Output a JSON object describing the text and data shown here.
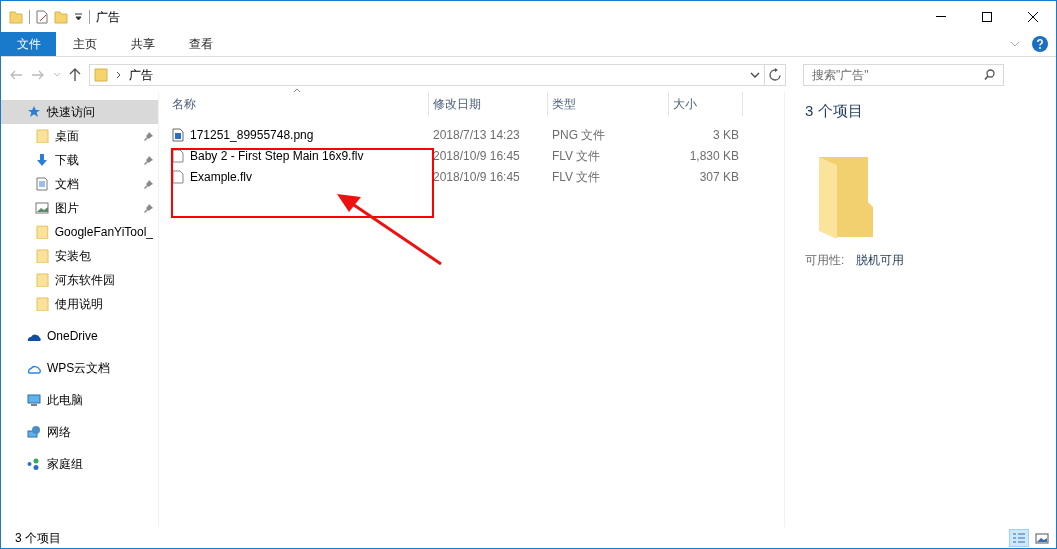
{
  "window": {
    "title": "广告"
  },
  "ribbon_tabs": [
    {
      "label": "文件",
      "kind": "file",
      "selected": false
    },
    {
      "label": "主页",
      "kind": "tab",
      "selected": false
    },
    {
      "label": "共享",
      "kind": "tab",
      "selected": false
    },
    {
      "label": "查看",
      "kind": "tab",
      "selected": false
    }
  ],
  "address_bar": {
    "path": [
      "广告"
    ]
  },
  "search": {
    "placeholder": "搜索\"广告\""
  },
  "sidebar": {
    "items": [
      {
        "label": "快速访问",
        "kind": "star",
        "selected": true,
        "children": [
          {
            "label": "桌面",
            "kind": "folder",
            "pinned": true,
            "selected": false
          },
          {
            "label": "下载",
            "kind": "download",
            "pinned": true,
            "selected": false
          },
          {
            "label": "文档",
            "kind": "document",
            "pinned": true,
            "selected": false
          },
          {
            "label": "图片",
            "kind": "pictures",
            "pinned": true,
            "selected": false
          },
          {
            "label": "GoogleFanYiTool_",
            "kind": "folder",
            "pinned": false,
            "selected": false
          },
          {
            "label": "安装包",
            "kind": "folder",
            "pinned": false,
            "selected": false
          },
          {
            "label": "河东软件园",
            "kind": "folder",
            "pinned": false,
            "selected": false
          },
          {
            "label": "使用说明",
            "kind": "folder",
            "pinned": false,
            "selected": false
          }
        ]
      },
      {
        "label": "OneDrive",
        "kind": "onedrive",
        "selected": false
      },
      {
        "label": "WPS云文档",
        "kind": "cloud",
        "selected": false
      },
      {
        "label": "此电脑",
        "kind": "computer",
        "selected": false
      },
      {
        "label": "网络",
        "kind": "network",
        "selected": false
      },
      {
        "label": "家庭组",
        "kind": "homegroup",
        "selected": false
      }
    ]
  },
  "file_list": {
    "columns": [
      "名称",
      "修改日期",
      "类型",
      "大小"
    ],
    "rows": [
      {
        "name": "171251_89955748.png",
        "kind": "image",
        "date": "2018/7/13 14:23",
        "type": "PNG 文件",
        "size": "3 KB"
      },
      {
        "name": "Baby 2 - First Step Main 16x9.flv",
        "kind": "file",
        "date": "2018/10/9 16:45",
        "type": "FLV 文件",
        "size": "1,830 KB"
      },
      {
        "name": "Example.flv",
        "kind": "file",
        "date": "2018/10/9 16:45",
        "type": "FLV 文件",
        "size": "307 KB"
      }
    ]
  },
  "details_pane": {
    "count": "3 个项目",
    "property_label": "可用性:",
    "property_value": "脱机可用"
  },
  "status_bar": {
    "count": "3 个项目",
    "views": [
      {
        "kind": "details",
        "selected": true
      },
      {
        "kind": "thumbnails",
        "selected": false
      }
    ]
  }
}
